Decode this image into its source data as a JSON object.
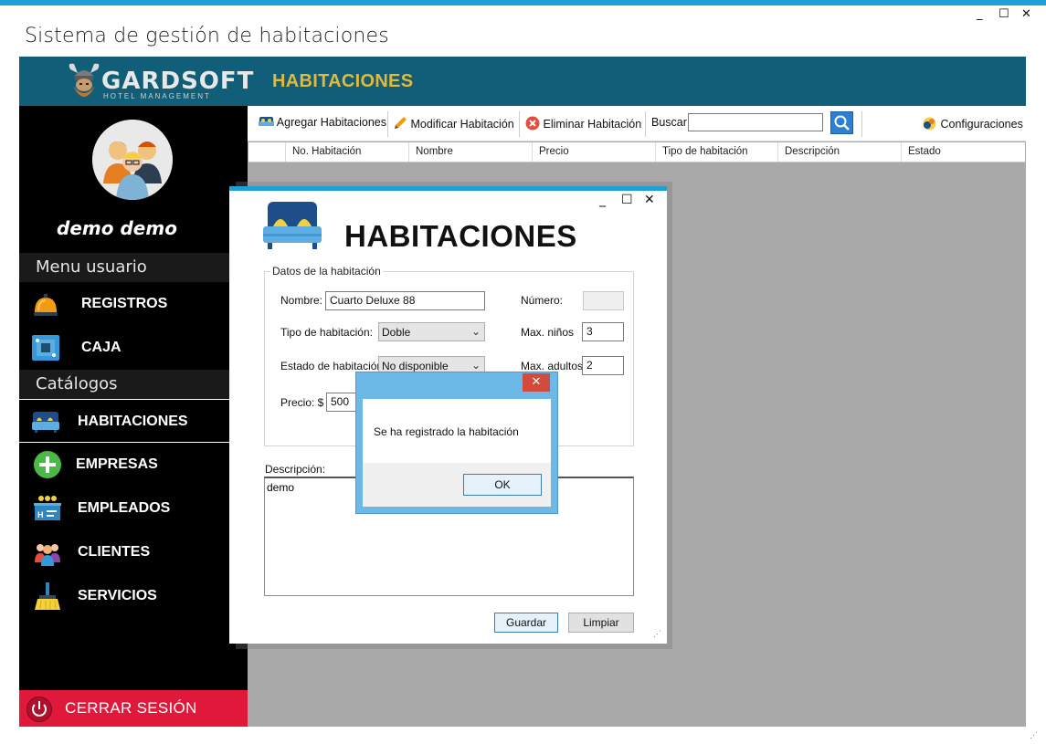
{
  "window": {
    "title": "Sistema de gestión de habitaciones",
    "controls": {
      "minimize": "_",
      "maximize": "☐",
      "close": "✕"
    }
  },
  "brand": {
    "logo_text": "GARDSOFT",
    "logo_sub": "HOTEL MANAGEMENT"
  },
  "header": {
    "title": "HABITACIONES"
  },
  "sidebar": {
    "username": "demo demo",
    "section_user": "Menu usuario",
    "section_catalogs": "Catálogos",
    "items": [
      {
        "label": "REGISTROS",
        "icon": "bell-icon"
      },
      {
        "label": "CAJA",
        "icon": "cash-register-icon"
      },
      {
        "label": "HABITACIONES",
        "icon": "bed-icon",
        "active": true
      },
      {
        "label": "EMPRESAS",
        "icon": "plus-circle-icon"
      },
      {
        "label": "EMPLEADOS",
        "icon": "reception-desk-icon"
      },
      {
        "label": "CLIENTES",
        "icon": "users-icon"
      },
      {
        "label": "SERVICIOS",
        "icon": "broom-icon"
      }
    ],
    "logout": "CERRAR SESIÓN"
  },
  "toolbar": {
    "add": "Agregar Habitaciones",
    "edit": "Modificar Habitación",
    "delete": "Eliminar Habitación",
    "search_label": "Buscar",
    "search_value": "",
    "settings": "Configuraciones"
  },
  "grid": {
    "columns": [
      "No. Habitación",
      "Nombre",
      "Precio",
      "Tipo de habitación",
      "Descripción",
      "Estado"
    ]
  },
  "dialog": {
    "title": "HABITACIONES",
    "controls": {
      "minimize": "_",
      "maximize": "☐",
      "close": "✕"
    },
    "group_label": "Datos de la habitación",
    "fields": {
      "nombre_label": "Nombre:",
      "nombre_value": "Cuarto Deluxe 88",
      "numero_label": "Número:",
      "numero_value": "",
      "tipo_label": "Tipo de habitación:",
      "tipo_value": "Doble",
      "ninos_label": "Max. niños",
      "ninos_value": "3",
      "estado_label": "Estado de habitación:",
      "estado_value": "No disponible",
      "adultos_label": "Max. adultos",
      "adultos_value": "2",
      "precio_label": "Precio: $",
      "precio_value": "500",
      "descripcion_label": "Descripción:",
      "descripcion_value": "demo"
    },
    "buttons": {
      "save": "Guardar",
      "clear": "Limpiar"
    }
  },
  "message_box": {
    "text": "Se ha registrado la habitación",
    "ok": "OK",
    "close": "✕"
  },
  "colors": {
    "accent_blue": "#1ea0d6",
    "header_teal": "#105e78",
    "header_title_gold": "#e3b93b",
    "logout_red": "#e0193a",
    "workspace_gray": "#a9a9a9"
  }
}
